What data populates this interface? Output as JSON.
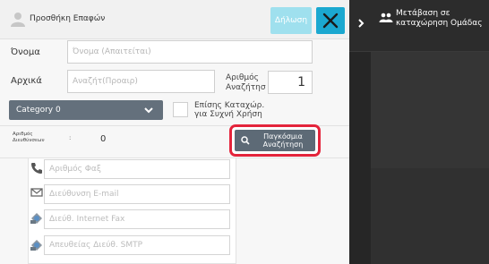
{
  "header": {
    "title": "Προσθήκη Επαφών",
    "confirm_label": "Δήλωση"
  },
  "form": {
    "name_label": "Όνομα",
    "name_placeholder": "Όνομα (Απαιτείται)",
    "initial_label": "Αρχικά",
    "initial_placeholder": "Αναζήτ(Προαιρ)",
    "search_number_label_line1": "Αριθμός",
    "search_number_label_line2": "Αναζήτησ",
    "search_number_value": "1",
    "category_value": "Category 0",
    "frequent_use_line1": "Επίσης Καταχώρ.",
    "frequent_use_line2": "για Συχνή Χρήση",
    "address_count_label_line1": "Αριθμός",
    "address_count_label_line2": "Διευθύνσεων",
    "address_count_colon": ":",
    "address_count_value": "0",
    "global_search_line1": "Παγκόσμια",
    "global_search_line2": "Αναζήτηση"
  },
  "contacts": [
    {
      "icon": "fax-icon",
      "placeholder": "Αριθμός Φαξ"
    },
    {
      "icon": "email-icon",
      "placeholder": "Διεύθυνση E-mail"
    },
    {
      "icon": "internet-fax-icon",
      "placeholder": "Διεύθ. Internet Fax"
    },
    {
      "icon": "smtp-icon",
      "placeholder": "Απευθείας Διεύθ. SMTP"
    }
  ],
  "sidebar": {
    "line1": "Μετάβαση σε",
    "line2": "καταχώρηση Ομάδας"
  },
  "colors": {
    "accent": "#1ba8d0",
    "confirm_disabled": "#9fe0ee",
    "highlight": "#e4243b",
    "dark_button": "#5d6a76",
    "sidebar_bg": "#2c2c2c"
  }
}
